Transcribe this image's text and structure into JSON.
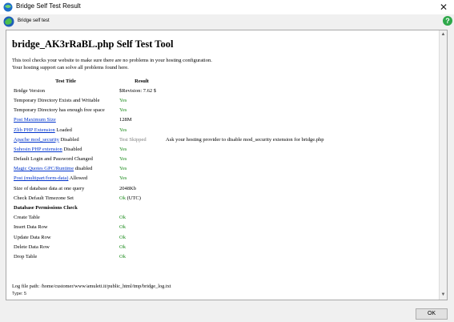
{
  "window": {
    "title": "Bridge Self Test Result",
    "close_glyph": "✕"
  },
  "header": {
    "label": "Bridge self test"
  },
  "page": {
    "title": "bridge_AK3rRaBL.php Self Test Tool",
    "intro_lines": [
      "This tool checks your website to make sure there are no problems in your hosting configuration.",
      "Your hosting support can solve all problems found here."
    ],
    "col_test": "Test Title",
    "col_result": "Result",
    "rows": [
      {
        "name": "Bridge Version",
        "result": "$Revision: 7.62 $",
        "result_class": "",
        "note": ""
      },
      {
        "name": "Temporary Directory Exists and Writable",
        "result": "Yes",
        "result_class": "ok",
        "note": ""
      },
      {
        "name": "Temporary Directory has enough free space",
        "result": "Yes",
        "result_class": "ok",
        "note": ""
      },
      {
        "link": "Post Maximum Size",
        "suffix": "",
        "result": "128M",
        "result_class": "",
        "note": ""
      },
      {
        "link": "Zlib PHP Extension",
        "suffix": " Loaded",
        "result": "Yes",
        "result_class": "ok",
        "note": ""
      },
      {
        "link": "Apache mod_security",
        "suffix": " Disabled",
        "result": "Test Skipped",
        "result_class": "skip",
        "note": "Ask your hosting provider to disable mod_security extension for bridge.php"
      },
      {
        "link": "Suhosin PHP extension",
        "suffix": " Disabled",
        "result": "Yes",
        "result_class": "ok",
        "note": ""
      },
      {
        "name": "Default Login and Password Changed",
        "result": "Yes",
        "result_class": "ok",
        "note": ""
      },
      {
        "link": "Magic Quotes GPC/Runtime",
        "suffix": " disabled",
        "result": "Yes",
        "result_class": "ok",
        "note": ""
      },
      {
        "link": "Post (multipart/form-data)",
        "suffix": " Allowed",
        "result": "Yes",
        "result_class": "ok",
        "note": ""
      },
      {
        "name": "Size of database data at one query",
        "result": "2048Kb",
        "result_class": "",
        "note": ""
      },
      {
        "name": "Check Default Timezone Set",
        "result": "Ok",
        "result_class": "ok",
        "result_extra": " (UTC)",
        "note": ""
      }
    ],
    "db_section": "Database Permissions Check",
    "db_rows": [
      {
        "name": "Create Table",
        "result": "Ok"
      },
      {
        "name": "Insert Data Row",
        "result": "Ok"
      },
      {
        "name": "Update Data Row",
        "result": "Ok"
      },
      {
        "name": "Delete Data Row",
        "result": "Ok"
      },
      {
        "name": "Drop Table",
        "result": "Ok"
      }
    ],
    "log_line": "Log file path: /home/customer/www/amuleti.it/public_html/tmp/bridge_log.txt",
    "type_line": "Type: 5"
  },
  "footer": {
    "ok_label": "OK"
  }
}
